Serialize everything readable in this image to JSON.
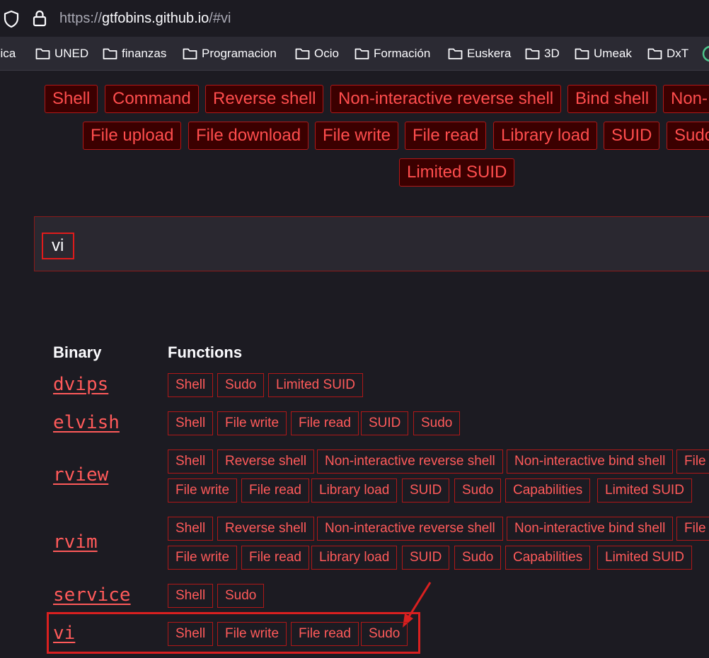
{
  "browser": {
    "url_scheme": "https://",
    "url_host": "gtfobins.github.io",
    "url_path": "/#vi"
  },
  "bookmarks": [
    "sica",
    "UNED",
    "finanzas",
    "Programacion",
    "Ocio",
    "Formación",
    "Euskera",
    "3D",
    "Umeak",
    "DxT"
  ],
  "filters": {
    "row1": [
      "Shell",
      "Command",
      "Reverse shell",
      "Non-interactive reverse shell",
      "Bind shell",
      "Non-"
    ],
    "row2": [
      "File upload",
      "File download",
      "File write",
      "File read",
      "Library load",
      "SUID",
      "Sudo"
    ],
    "row3": [
      "Limited SUID"
    ]
  },
  "search": {
    "value": "vi"
  },
  "table": {
    "headers": [
      "Binary",
      "Functions"
    ],
    "rows": [
      {
        "binary": "dvips",
        "lines": [
          [
            "Shell",
            "Sudo",
            "Limited SUID"
          ]
        ]
      },
      {
        "binary": "elvish",
        "lines": [
          [
            "Shell",
            "File write",
            "File read",
            "SUID",
            "Sudo"
          ]
        ]
      },
      {
        "binary": "rview",
        "lines": [
          [
            "Shell",
            "Reverse shell",
            "Non-interactive reverse shell",
            "Non-interactive bind shell",
            "File"
          ],
          [
            "File write",
            "File read",
            "Library load",
            "SUID",
            "Sudo",
            "Capabilities",
            "Limited SUID"
          ]
        ]
      },
      {
        "binary": "rvim",
        "lines": [
          [
            "Shell",
            "Reverse shell",
            "Non-interactive reverse shell",
            "Non-interactive bind shell",
            "File"
          ],
          [
            "File write",
            "File read",
            "Library load",
            "SUID",
            "Sudo",
            "Capabilities",
            "Limited SUID"
          ]
        ]
      },
      {
        "binary": "service",
        "lines": [
          [
            "Shell",
            "Sudo"
          ]
        ]
      },
      {
        "binary": "vi",
        "lines": [
          [
            "Shell",
            "File write",
            "File read",
            "Sudo"
          ]
        ]
      }
    ]
  },
  "colors": {
    "accent": "#ff4d4d",
    "tag_border": "#b01818",
    "annotation": "#d92020",
    "background": "#1c1b22"
  }
}
